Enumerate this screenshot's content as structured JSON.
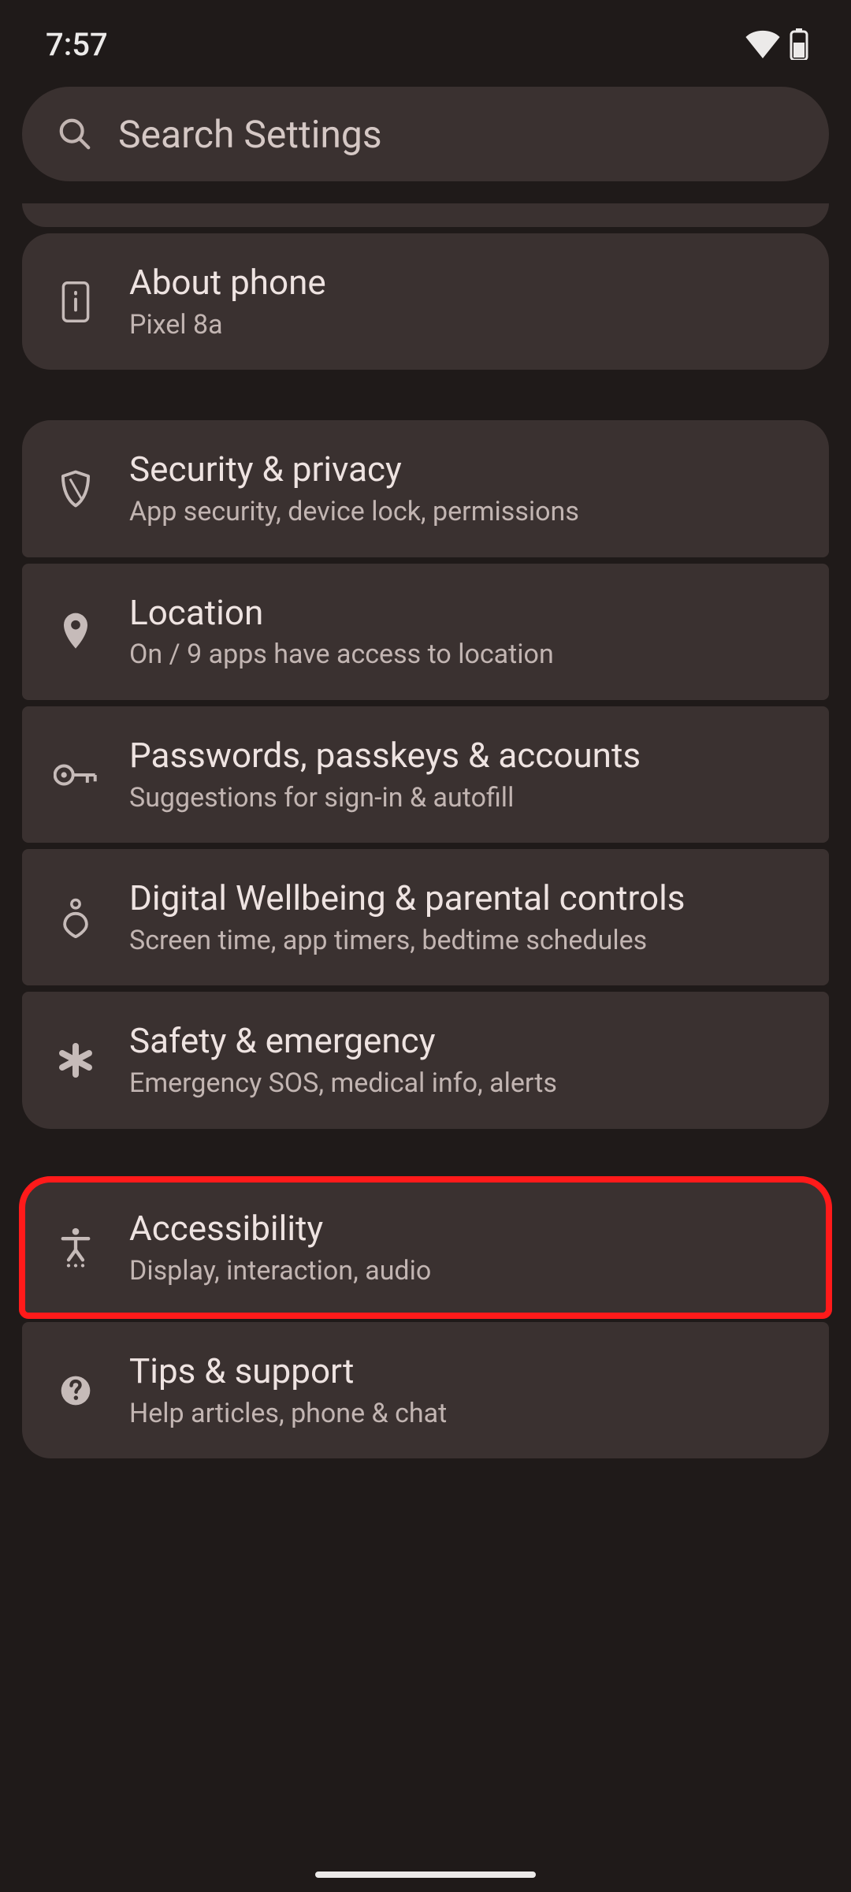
{
  "status": {
    "time": "7:57"
  },
  "search": {
    "placeholder": "Search Settings"
  },
  "items": {
    "about": {
      "title": "About phone",
      "subtitle": "Pixel 8a"
    },
    "security": {
      "title": "Security & privacy",
      "subtitle": "App security, device lock, permissions"
    },
    "location": {
      "title": "Location",
      "subtitle": "On / 9 apps have access to location"
    },
    "passwords": {
      "title": "Passwords, passkeys & accounts",
      "subtitle": "Suggestions for sign-in & autofill"
    },
    "wellbeing": {
      "title": "Digital Wellbeing & parental controls",
      "subtitle": "Screen time, app timers, bedtime schedules"
    },
    "safety": {
      "title": "Safety & emergency",
      "subtitle": "Emergency SOS, medical info, alerts"
    },
    "accessibility": {
      "title": "Accessibility",
      "subtitle": "Display, interaction, audio"
    },
    "tips": {
      "title": "Tips & support",
      "subtitle": "Help articles, phone & chat"
    }
  }
}
